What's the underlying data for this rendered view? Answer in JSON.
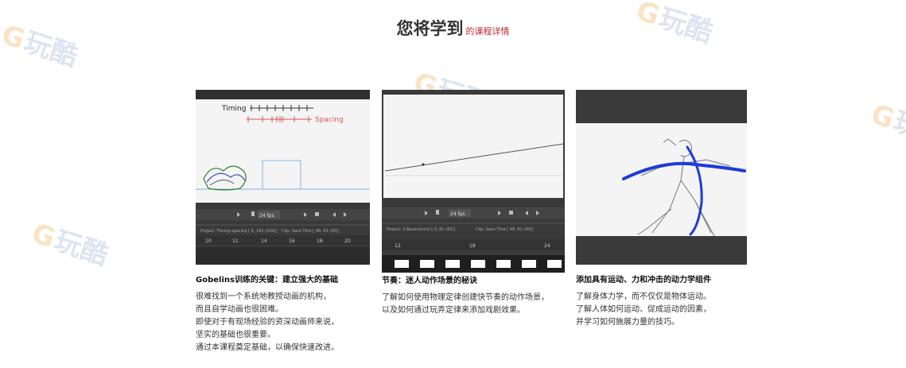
{
  "heading": {
    "main": "您将学到",
    "sub": "的课程详情"
  },
  "watermark": {
    "text": "玩酷"
  },
  "cards": [
    {
      "title": "Gobelins训练的关键：建立强大的基础",
      "lines": [
        "很难找到一个系统地教授动画的机构，",
        "而且自学动画也很困难。",
        "即使对于有现场经验的资深动画师来说，",
        "坚实的基础也很重要。",
        "通过本课程奠定基础，以确保快速改进。"
      ],
      "thumb": {
        "timing_label": "Timing",
        "spacing_label": "Spacing",
        "fps": "24 fps",
        "project": "Project: Timing-spacing [ 0, 192 (192)]",
        "clip": "Clip: Sans Titre [ 98, 91 (20)]",
        "ruler": [
          "10",
          "11",
          "14",
          "16",
          "18",
          "20"
        ]
      }
    },
    {
      "title": "节奏：迷人动作场景的秘诀",
      "lines": [
        "了解如何使用物理定律创建快节奏的动作场景，",
        "以及如何通过玩弄定律来添加戏剧效果。"
      ],
      "thumb": {
        "fps": "24 fps",
        "project": "Project: 1-Basecontrol [ 0, 81 (82)]",
        "clip": "Clip: Sans Titre [ 48, 81 (40)]",
        "ruler": [
          "12",
          "18",
          "24"
        ]
      }
    },
    {
      "title": "添加具有运动、力和冲击的动力学组件",
      "lines": [
        "了解身体力学，而不仅仅是物体运动。",
        "了解人体如何运动、促成运动的因素，",
        "并学习如何施展力量的技巧。"
      ],
      "thumb": {}
    }
  ],
  "colors": {
    "accent_red": "#c0272d",
    "timeline_dark": "#3a3a3a",
    "stroke_blue": "#1f3bd6",
    "spacing_red": "#d9534f"
  }
}
